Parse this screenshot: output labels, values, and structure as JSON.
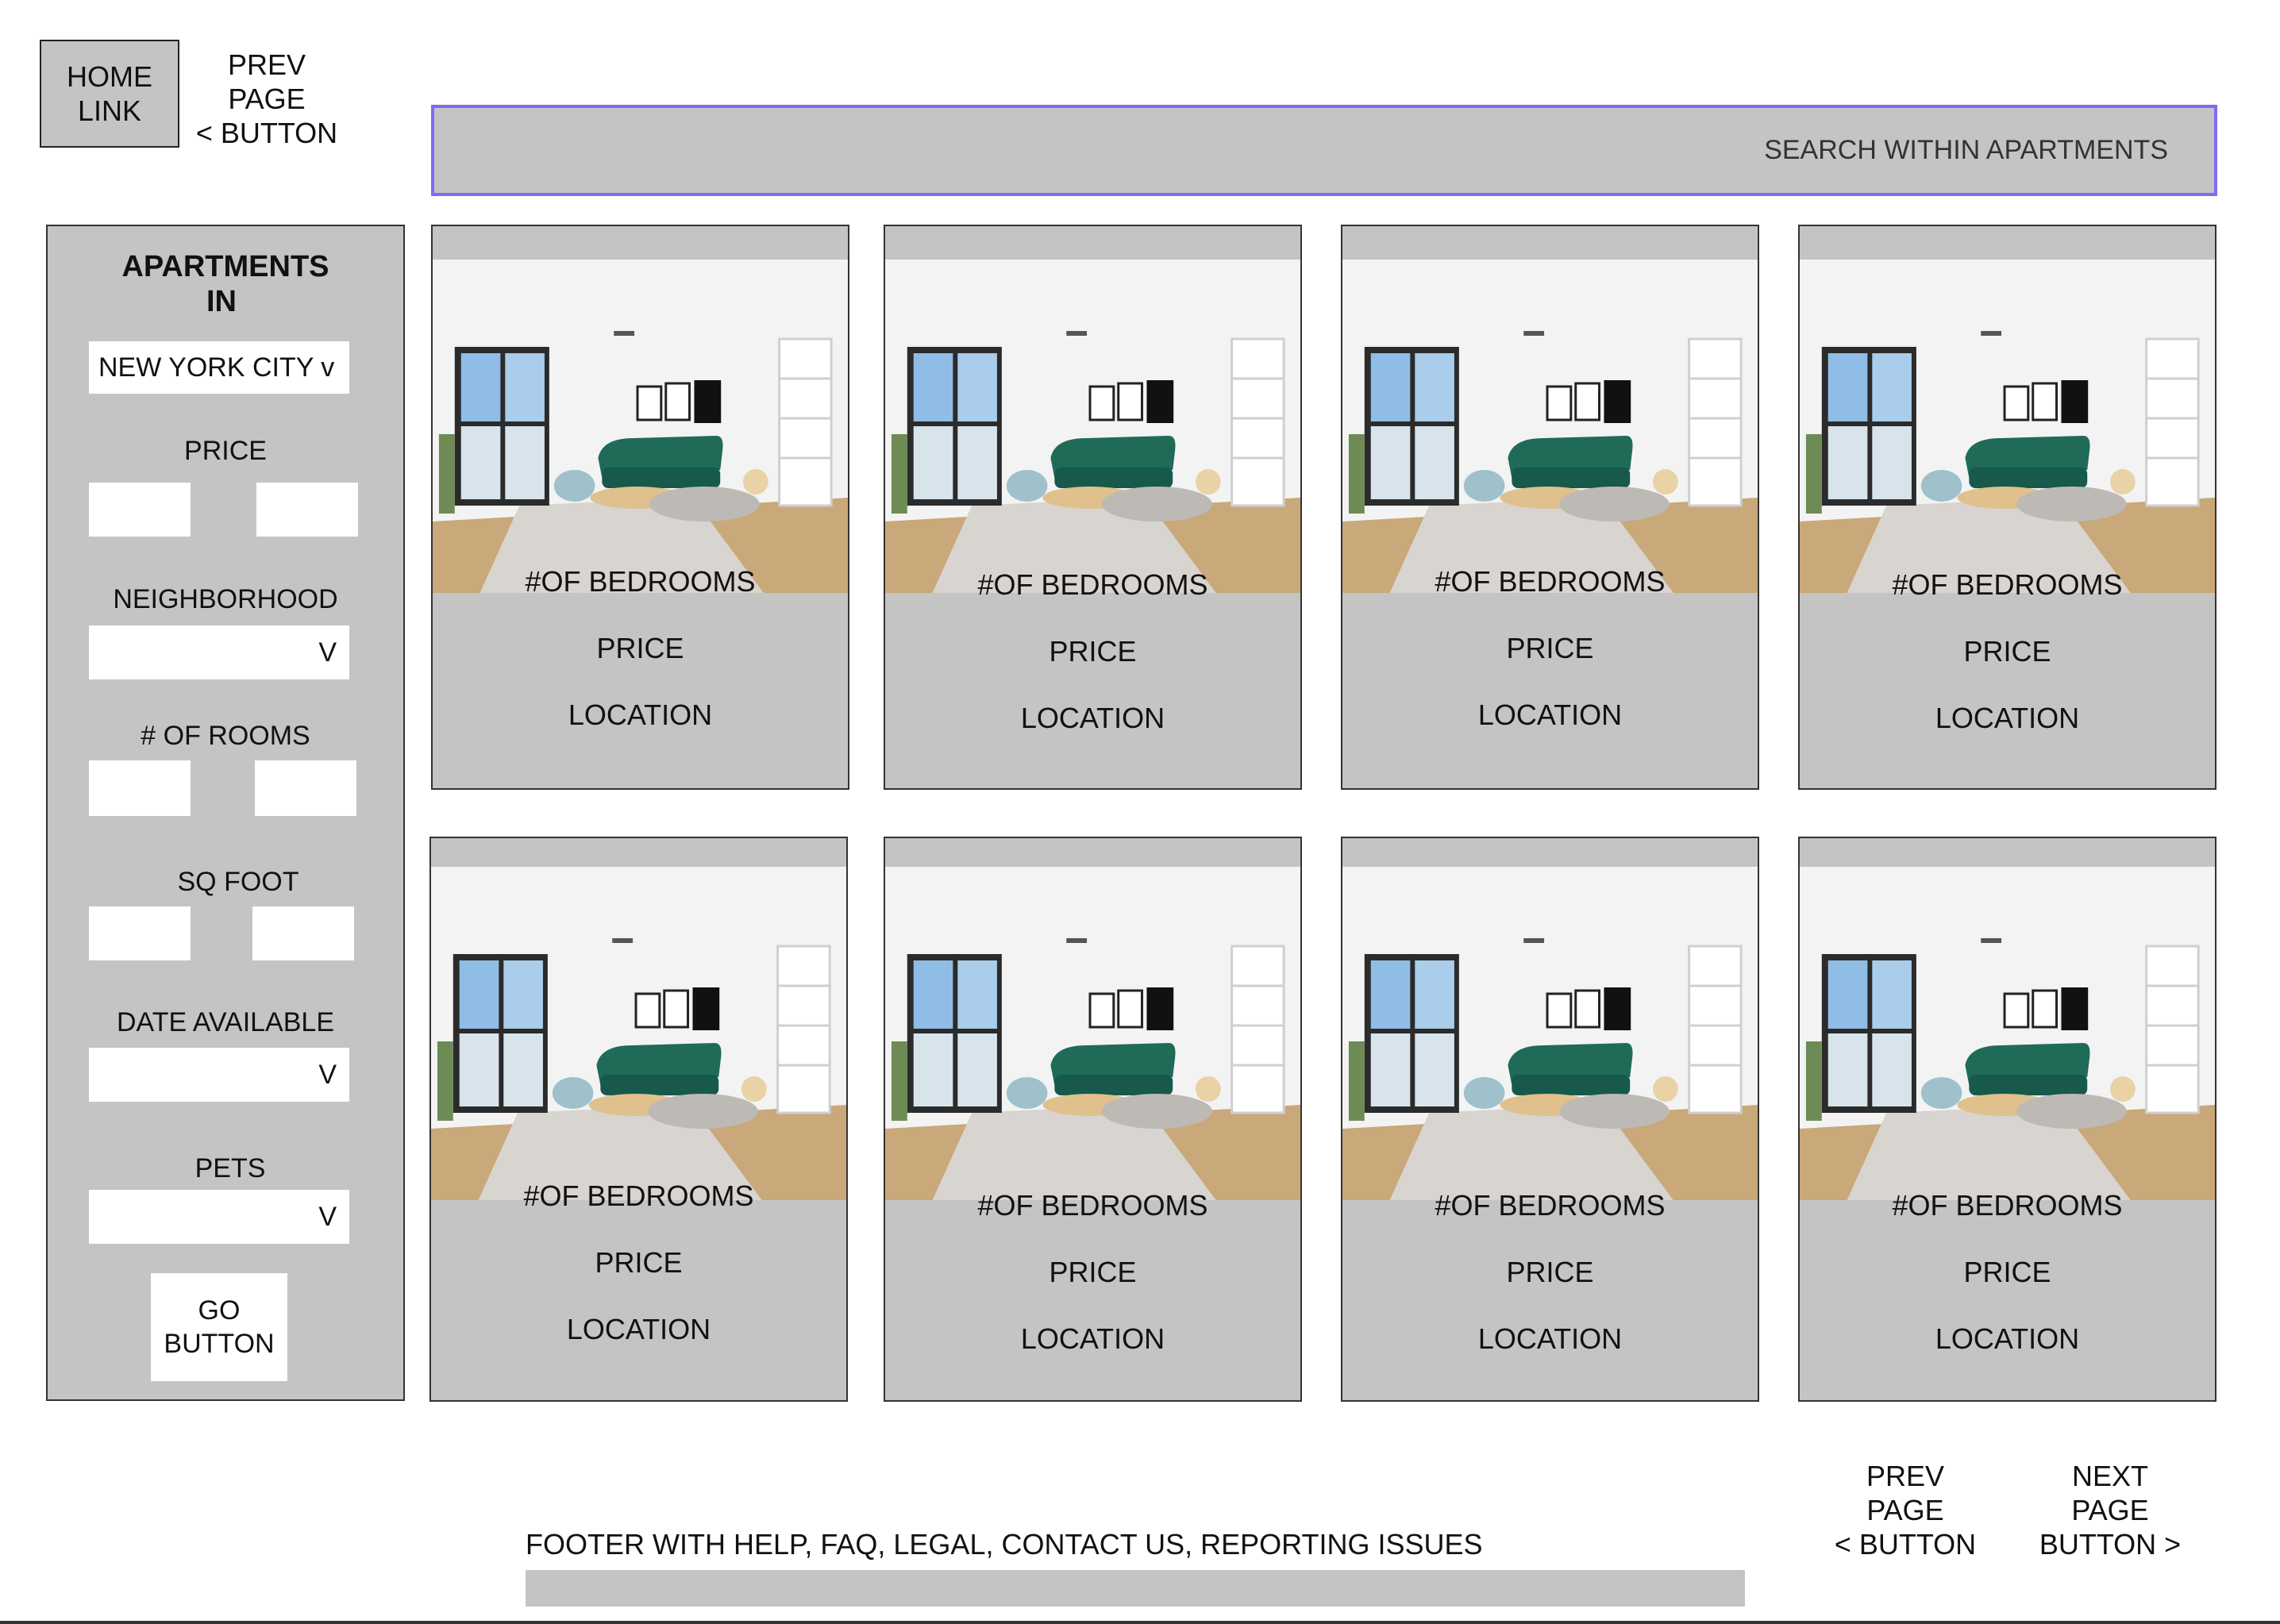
{
  "header": {
    "home_line1": "HOME",
    "home_line2": "LINK",
    "prev_line1": "PREV PAGE",
    "prev_line2": "< BUTTON"
  },
  "search": {
    "placeholder": "SEARCH WITHIN APARTMENTS"
  },
  "sidebar": {
    "heading_line1": "APARTMENTS",
    "heading_line2": "IN",
    "city_select": "NEW YORK CITY v",
    "price_label": "PRICE",
    "neighborhood_label": "NEIGHBORHOOD",
    "neighborhood_chevron": "V",
    "rooms_label": "# OF ROOMS",
    "sqfoot_label": "SQ FOOT",
    "date_label": "DATE AVAILABLE",
    "date_chevron": "V",
    "pets_label": "PETS",
    "pets_chevron": "V",
    "go_line1": "GO",
    "go_line2": "BUTTON"
  },
  "listings": [
    {
      "bedrooms": "#OF BEDROOMS",
      "price": "PRICE",
      "location": "LOCATION"
    },
    {
      "bedrooms": "#OF BEDROOMS",
      "price": "PRICE",
      "location": "LOCATION"
    },
    {
      "bedrooms": "#OF BEDROOMS",
      "price": "PRICE",
      "location": "LOCATION"
    },
    {
      "bedrooms": "#OF BEDROOMS",
      "price": "PRICE",
      "location": "LOCATION"
    },
    {
      "bedrooms": "#OF BEDROOMS",
      "price": "PRICE",
      "location": "LOCATION"
    },
    {
      "bedrooms": "#OF BEDROOMS",
      "price": "PRICE",
      "location": "LOCATION"
    },
    {
      "bedrooms": "#OF BEDROOMS",
      "price": "PRICE",
      "location": "LOCATION"
    },
    {
      "bedrooms": "#OF BEDROOMS",
      "price": "PRICE",
      "location": "LOCATION"
    }
  ],
  "pagination": {
    "prev_line1": "PREV PAGE",
    "prev_line2": "< BUTTON",
    "next_line1": "NEXT PAGE",
    "next_line2": "BUTTON >"
  },
  "footer": {
    "text": "FOOTER WITH HELP, FAQ, LEGAL, CONTACT US, REPORTING ISSUES"
  },
  "colors": {
    "panel_gray": "#c4c4c4",
    "search_border": "#7b6cf2",
    "sofa_green": "#1f6b58"
  }
}
